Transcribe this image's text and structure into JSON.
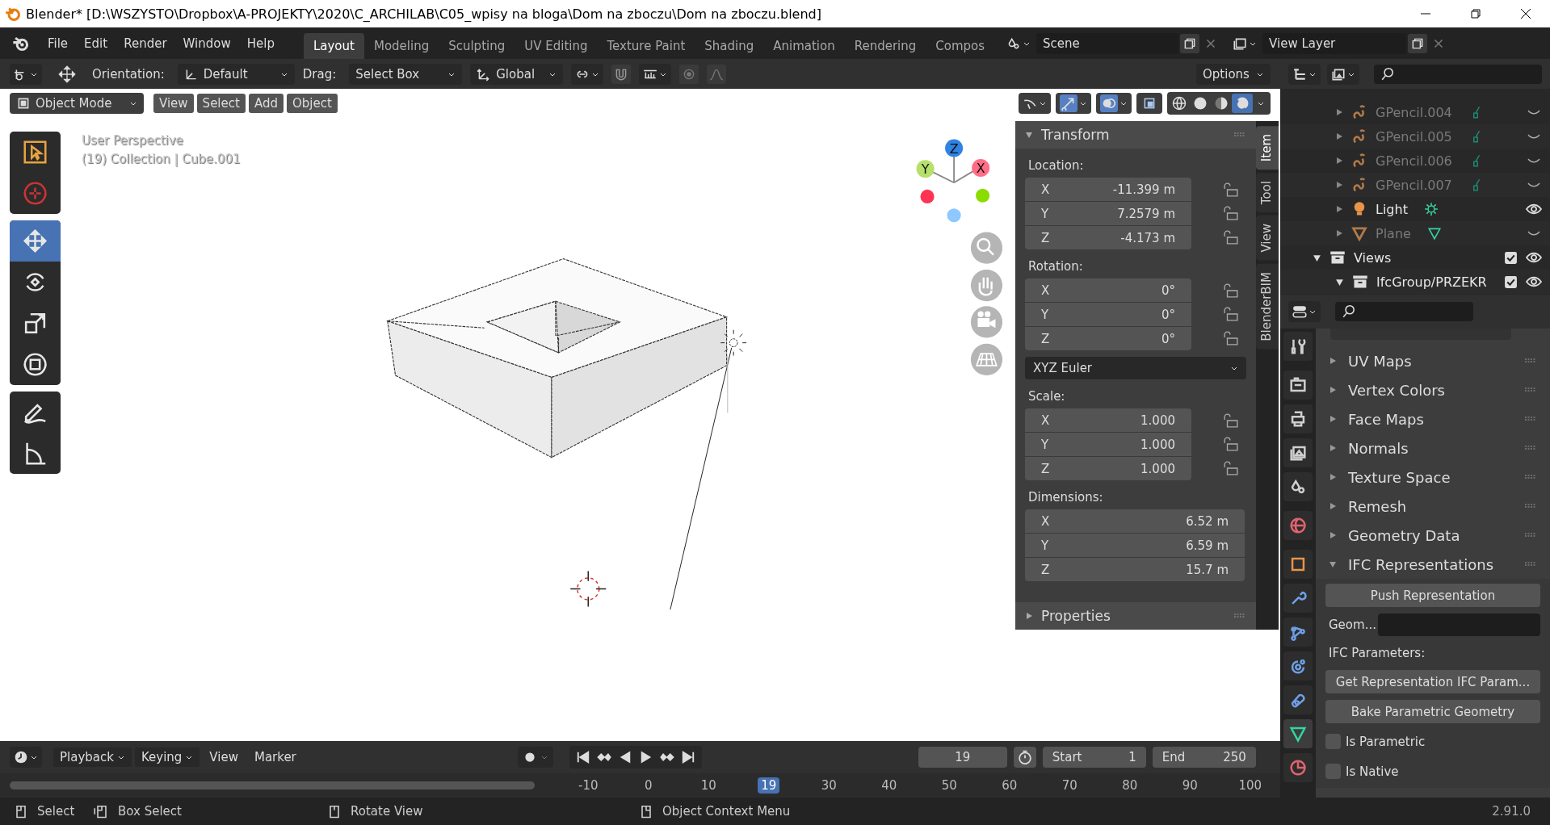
{
  "window": {
    "title": "Blender* [D:\\WSZYSTO\\Dropbox\\A-PROJEKTY\\2020\\C_ARCHILAB\\C05_wpisy na bloga\\Dom na zboczu\\Dom na zboczu.blend]"
  },
  "menu": [
    "File",
    "Edit",
    "Render",
    "Window",
    "Help"
  ],
  "workspaces": [
    {
      "label": "Layout",
      "selected": true
    },
    {
      "label": "Modeling",
      "selected": false
    },
    {
      "label": "Sculpting",
      "selected": false
    },
    {
      "label": "UV Editing",
      "selected": false
    },
    {
      "label": "Texture Paint",
      "selected": false
    },
    {
      "label": "Shading",
      "selected": false
    },
    {
      "label": "Animation",
      "selected": false
    },
    {
      "label": "Rendering",
      "selected": false
    },
    {
      "label": "Compos",
      "selected": false
    }
  ],
  "scene": "Scene",
  "view_layer": "View Layer",
  "tool_settings": {
    "orientation_label": "Orientation:",
    "orientation": "Default",
    "drag_label": "Drag:",
    "drag": "Select Box",
    "transform_orientation": "Global",
    "options": "Options"
  },
  "viewport": {
    "mode": "Object Mode",
    "menus": [
      "View",
      "Select",
      "Add",
      "Object"
    ],
    "perspective": "User Perspective",
    "info": "(19) Collection | Cube.001",
    "axes": [
      {
        "label": "Z"
      },
      {
        "label": "Y"
      },
      {
        "label": "X"
      }
    ],
    "toggles": [
      {
        "kind": "gizmo",
        "on": true
      },
      {
        "kind": "overlay",
        "on": true
      },
      {
        "kind": "xray",
        "on": false
      }
    ],
    "shading": [
      {
        "kind": "wireframe",
        "selected": false
      },
      {
        "kind": "solid",
        "selected": false
      },
      {
        "kind": "material",
        "selected": false
      },
      {
        "kind": "rendered",
        "selected": true
      }
    ]
  },
  "toolbar": [
    {
      "tools": [
        {
          "kind": "select_box",
          "selected": false
        },
        {
          "kind": "cursor",
          "selected": false
        }
      ]
    },
    {
      "tools": [
        {
          "kind": "move",
          "selected": true
        },
        {
          "kind": "rotate",
          "selected": false
        },
        {
          "kind": "scale",
          "selected": false
        },
        {
          "kind": "transform",
          "selected": false
        }
      ]
    },
    {
      "tools": [
        {
          "kind": "annotate",
          "selected": false
        },
        {
          "kind": "measure",
          "selected": false
        }
      ]
    }
  ],
  "sidebar": {
    "tabs": [
      {
        "label": "Item",
        "selected": true
      },
      {
        "label": "Tool",
        "selected": false
      },
      {
        "label": "View",
        "selected": false
      },
      {
        "label": "BlenderBIM",
        "selected": false
      }
    ],
    "transform": {
      "title": "Transform",
      "expanded": true,
      "items": [
        {
          "kind": "group",
          "label": "Location:",
          "lockable": true,
          "rows": [
            {
              "axis": "X",
              "value": "-11.399 m"
            },
            {
              "axis": "Y",
              "value": "7.2579 m"
            },
            {
              "axis": "Z",
              "value": "-4.173 m"
            }
          ]
        },
        {
          "kind": "group",
          "label": "Rotation:",
          "lockable": true,
          "rows": [
            {
              "axis": "X",
              "value": "0°"
            },
            {
              "axis": "Y",
              "value": "0°"
            },
            {
              "axis": "Z",
              "value": "0°"
            }
          ]
        },
        {
          "kind": "dropdown",
          "value": "XYZ Euler"
        },
        {
          "kind": "group",
          "label": "Scale:",
          "lockable": true,
          "rows": [
            {
              "axis": "X",
              "value": "1.000"
            },
            {
              "axis": "Y",
              "value": "1.000"
            },
            {
              "axis": "Z",
              "value": "1.000"
            }
          ]
        },
        {
          "kind": "group",
          "label": "Dimensions:",
          "lockable": false,
          "rows": [
            {
              "axis": "X",
              "value": "6.52 m"
            },
            {
              "axis": "Y",
              "value": "6.59 m"
            },
            {
              "axis": "Z",
              "value": "15.7 m"
            }
          ]
        }
      ]
    },
    "properties_panel": {
      "title": "Properties",
      "expanded": false
    }
  },
  "outliner": {
    "items": [
      {
        "name": "GPencil.004",
        "kind": "gpencil",
        "visible": false,
        "expanded": false
      },
      {
        "name": "GPencil.005",
        "kind": "gpencil",
        "visible": false,
        "expanded": false
      },
      {
        "name": "GPencil.006",
        "kind": "gpencil",
        "visible": false,
        "expanded": false
      },
      {
        "name": "GPencil.007",
        "kind": "gpencil",
        "visible": false,
        "expanded": false
      },
      {
        "name": "Light",
        "kind": "light",
        "visible": true,
        "expanded": false
      },
      {
        "name": "Plane",
        "kind": "mesh",
        "visible": false,
        "expanded": false
      },
      {
        "name": "Views",
        "kind": "collection",
        "visible": true,
        "checked": true,
        "expanded": true,
        "children": [
          {
            "name": "IfcGroup/PRZEKR",
            "kind": "collection",
            "visible": true,
            "checked": true,
            "expanded": true
          }
        ]
      }
    ]
  },
  "properties_editor": {
    "tabs": [
      {
        "kind": "tool",
        "selected": false
      },
      {
        "kind": "render",
        "selected": false
      },
      {
        "kind": "output",
        "selected": false
      },
      {
        "kind": "view_layer",
        "selected": false
      },
      {
        "kind": "scene",
        "selected": false
      },
      {
        "kind": "world",
        "selected": false
      },
      {
        "kind": "object",
        "selected": false
      },
      {
        "kind": "modifier",
        "selected": false
      },
      {
        "kind": "particles",
        "selected": false
      },
      {
        "kind": "physics",
        "selected": false
      },
      {
        "kind": "constraint",
        "selected": false
      },
      {
        "kind": "data",
        "selected": true
      },
      {
        "kind": "material",
        "selected": false
      }
    ],
    "panels": [
      {
        "title": "UV Maps",
        "expanded": false
      },
      {
        "title": "Vertex Colors",
        "expanded": false
      },
      {
        "title": "Face Maps",
        "expanded": false
      },
      {
        "title": "Normals",
        "expanded": false
      },
      {
        "title": "Texture Space",
        "expanded": false
      },
      {
        "title": "Remesh",
        "expanded": false
      },
      {
        "title": "Geometry Data",
        "expanded": false
      },
      {
        "title": "IFC Representations",
        "expanded": true
      }
    ],
    "ifc": {
      "push": "Push Representation",
      "geom_label": "Geom...",
      "params_label": "IFC Parameters:",
      "get": "Get Representation IFC Param...",
      "bake": "Bake Parametric Geometry",
      "checks": [
        {
          "label": "Is Parametric",
          "checked": false
        },
        {
          "label": "Is Native",
          "checked": false
        }
      ]
    }
  },
  "timeline": {
    "menus": [
      {
        "label": "Playback",
        "dropdown": true
      },
      {
        "label": "Keying",
        "dropdown": true
      },
      {
        "label": "View",
        "dropdown": false
      },
      {
        "label": "Marker",
        "dropdown": false
      }
    ],
    "current_frame": "19",
    "start_label": "Start",
    "start": "1",
    "end_label": "End",
    "end": "250",
    "ticks": [
      {
        "label": "-10",
        "selected": false
      },
      {
        "label": "0",
        "selected": false
      },
      {
        "label": "10",
        "selected": false
      },
      {
        "label": "19",
        "selected": true
      },
      {
        "label": "30",
        "selected": false
      },
      {
        "label": "40",
        "selected": false
      },
      {
        "label": "50",
        "selected": false
      },
      {
        "label": "60",
        "selected": false
      },
      {
        "label": "70",
        "selected": false
      },
      {
        "label": "80",
        "selected": false
      },
      {
        "label": "90",
        "selected": false
      },
      {
        "label": "100",
        "selected": false
      }
    ]
  },
  "status_bar": {
    "items": [
      {
        "kind": "left",
        "label": "Select"
      },
      {
        "kind": "drag",
        "label": "Box Select"
      },
      {
        "kind": "middle",
        "label": "Rotate View"
      },
      {
        "kind": "right",
        "label": "Object Context Menu"
      }
    ],
    "version": "2.91.0"
  }
}
